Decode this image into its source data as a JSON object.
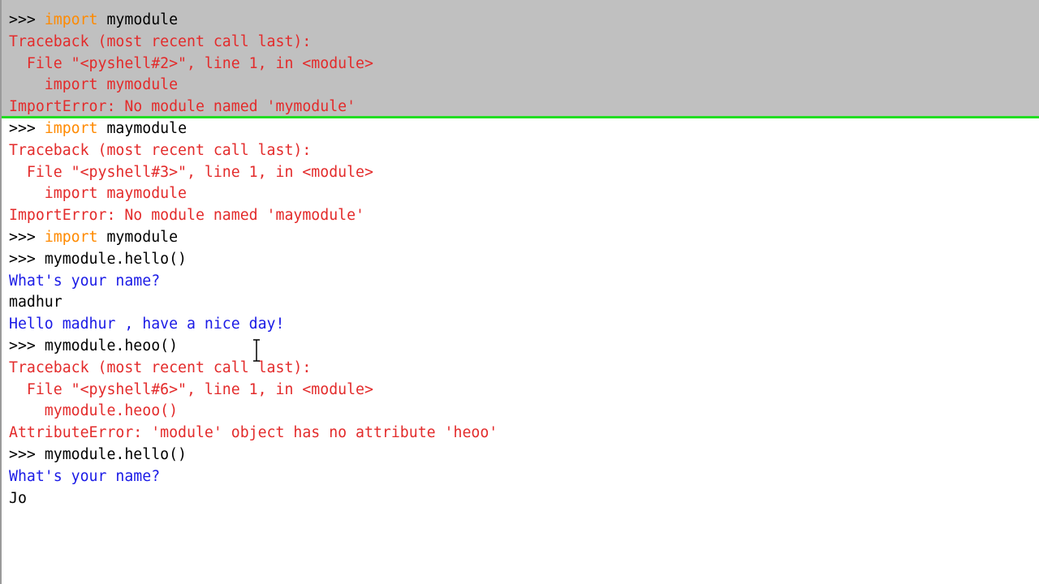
{
  "shell": {
    "prompt": ">>>",
    "top_clip_glyph": "'",
    "colors": {
      "stdout": "#000000",
      "stderr": "#e32b2b",
      "info": "#1a1ae6",
      "keyword": "#ff8a00",
      "selection": "#c0c0c0",
      "selection_border": "#22dd22"
    },
    "lines": [
      {
        "type": "prompt",
        "kw": "import",
        "rest": " mymodule"
      },
      {
        "type": "stderr",
        "text": "Traceback (most recent call last):"
      },
      {
        "type": "stderr",
        "text": "  File \"<pyshell#2>\", line 1, in <module>"
      },
      {
        "type": "stderr",
        "text": "    import mymodule"
      },
      {
        "type": "stderr",
        "text": "ImportError: No module named 'mymodule'"
      },
      {
        "type": "prompt",
        "kw": "import",
        "rest": " maymodule"
      },
      {
        "type": "stderr",
        "text": "Traceback (most recent call last):"
      },
      {
        "type": "stderr",
        "text": "  File \"<pyshell#3>\", line 1, in <module>"
      },
      {
        "type": "stderr",
        "text": "    import maymodule"
      },
      {
        "type": "stderr",
        "text": "ImportError: No module named 'maymodule'"
      },
      {
        "type": "prompt",
        "kw": "import",
        "rest": " mymodule"
      },
      {
        "type": "prompt",
        "kw": "",
        "rest": "mymodule.hello()"
      },
      {
        "type": "info",
        "text": "What's your name?"
      },
      {
        "type": "stdout",
        "text": "madhur"
      },
      {
        "type": "info",
        "text": "Hello madhur , have a nice day!"
      },
      {
        "type": "prompt",
        "kw": "",
        "rest": "mymodule.heoo()"
      },
      {
        "type": "stderr",
        "text": "Traceback (most recent call last):"
      },
      {
        "type": "stderr",
        "text": "  File \"<pyshell#6>\", line 1, in <module>"
      },
      {
        "type": "stderr",
        "text": "    mymodule.heoo()"
      },
      {
        "type": "stderr",
        "text": "AttributeError: 'module' object has no attribute 'heoo'"
      },
      {
        "type": "prompt",
        "kw": "",
        "rest": "mymodule.hello()"
      },
      {
        "type": "info",
        "text": "What's your name?"
      },
      {
        "type": "stdout",
        "text": "Jo"
      }
    ]
  }
}
